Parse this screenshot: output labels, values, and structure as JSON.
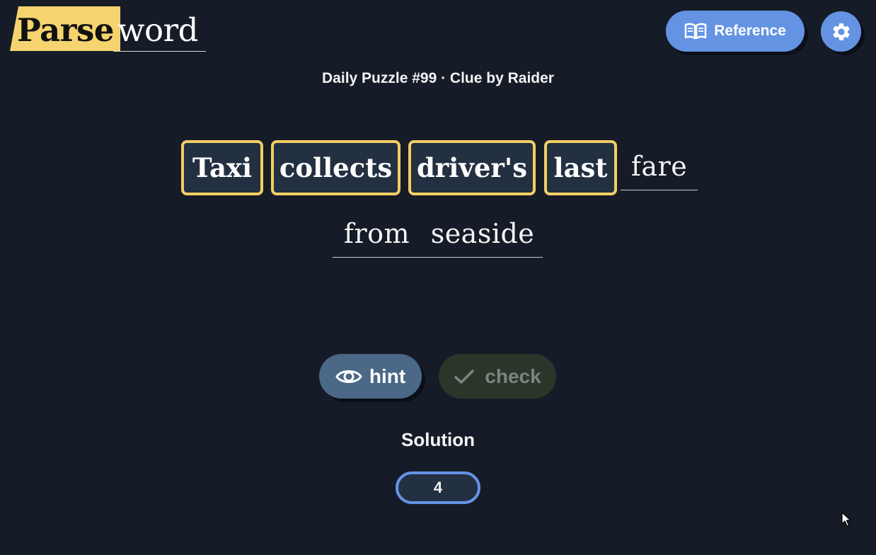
{
  "logo": {
    "part1": "Parse",
    "part2": "word"
  },
  "header": {
    "reference_label": "Reference",
    "reference_icon": "book-open-icon",
    "settings_icon": "gear-icon"
  },
  "subtitle": "Daily Puzzle #99 · Clue by Raider",
  "clue": {
    "words": [
      {
        "text": "Taxi",
        "selected": true
      },
      {
        "text": "collects",
        "selected": true
      },
      {
        "text": "driver's",
        "selected": true
      },
      {
        "text": "last",
        "selected": true
      },
      {
        "text": "fare",
        "selected": false
      },
      {
        "text": "from",
        "selected": false
      },
      {
        "text": "seaside",
        "selected": false
      }
    ]
  },
  "actions": {
    "hint_label": "hint",
    "hint_icon": "eye-icon",
    "check_label": "check",
    "check_icon": "checkmark-icon"
  },
  "solution": {
    "label": "Solution",
    "length": "4"
  },
  "colors": {
    "background": "#161c27",
    "accent_yellow": "#f2ce63",
    "accent_blue": "#6593e4",
    "hint_button": "#4b6886",
    "check_button_disabled": "#2a3629"
  }
}
